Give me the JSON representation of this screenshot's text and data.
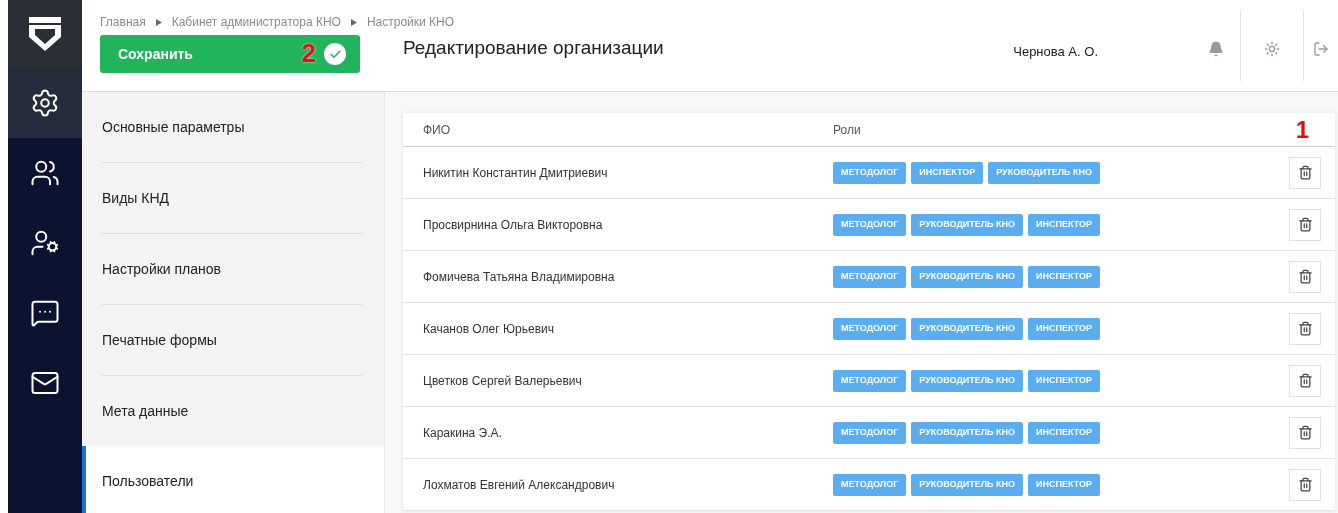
{
  "rail": [
    {
      "selected": true
    },
    {
      "selected": false
    },
    {
      "selected": false
    },
    {
      "selected": false
    },
    {
      "selected": false
    }
  ],
  "breadcrumbs": [
    "Главная",
    "Кабинет администратора КНО",
    "Настройки КНО"
  ],
  "save_button": {
    "label": "Сохранить",
    "marker": "2"
  },
  "page_title": "Редактирование организации",
  "user": {
    "name": "Чернова А. О."
  },
  "nav": [
    {
      "label": "Основные параметры",
      "selected": false
    },
    {
      "label": "Виды КНД",
      "selected": false
    },
    {
      "label": "Настройки планов",
      "selected": false
    },
    {
      "label": "Печатные формы",
      "selected": false
    },
    {
      "label": "Мета данные",
      "selected": false
    },
    {
      "label": "Пользователи",
      "selected": true
    }
  ],
  "table": {
    "columns": [
      "ФИО",
      "Роли"
    ],
    "marker": "1",
    "rows": [
      {
        "name": "Никитин Константин Дмитриевич",
        "roles": [
          "МЕТОДОЛОГ",
          "ИНСПЕКТОР",
          "РУКОВОДИТЕЛЬ КНО"
        ]
      },
      {
        "name": "Просвирнина Ольга Викторовна",
        "roles": [
          "МЕТОДОЛОГ",
          "РУКОВОДИТЕЛЬ КНО",
          "ИНСПЕКТОР"
        ]
      },
      {
        "name": "Фомичева Татьяна Владимировна",
        "roles": [
          "МЕТОДОЛОГ",
          "РУКОВОДИТЕЛЬ КНО",
          "ИНСПЕКТОР"
        ]
      },
      {
        "name": "Качанов Олег Юрьевич",
        "roles": [
          "МЕТОДОЛОГ",
          "РУКОВОДИТЕЛЬ КНО",
          "ИНСПЕКТОР"
        ]
      },
      {
        "name": "Цветков Сергей Валерьевич",
        "roles": [
          "МЕТОДОЛОГ",
          "РУКОВОДИТЕЛЬ КНО",
          "ИНСПЕКТОР"
        ]
      },
      {
        "name": "Каракина Э.А.",
        "roles": [
          "МЕТОДОЛОГ",
          "РУКОВОДИТЕЛЬ КНО",
          "ИНСПЕКТОР"
        ]
      },
      {
        "name": "Лохматов Евгений Александрович",
        "roles": [
          "МЕТОДОЛОГ",
          "РУКОВОДИТЕЛЬ КНО",
          "ИНСПЕКТОР"
        ]
      }
    ]
  }
}
